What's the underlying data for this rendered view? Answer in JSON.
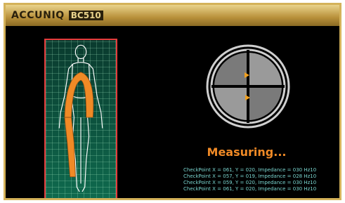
{
  "header": {
    "brand": "ACCUNIQ",
    "model": "BC510"
  },
  "status": {
    "text": "Measuring..."
  },
  "log": {
    "lines": [
      "CheckPoint X = 061, Y = 020, Impedance = 030 Hz10",
      "CheckPoint X = 057, Y = 019, Impedance = 028 Hz10",
      "CheckPoint X = 059, Y = 020, Impedance = 030 Hz10",
      "CheckPoint X = 061, Y = 020, Impedance = 030 Hz10"
    ]
  },
  "colors": {
    "frame_gold": "#d4b25a",
    "panel_border": "#e43b3b",
    "highlight_orange": "#f08a26",
    "log_text": "#7ad6d0"
  }
}
